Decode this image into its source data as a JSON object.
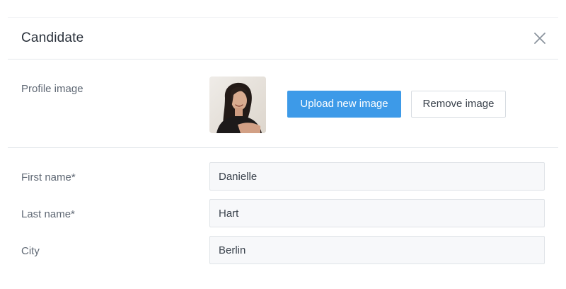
{
  "dialog": {
    "title": "Candidate",
    "close_icon": "close-icon"
  },
  "profile": {
    "label": "Profile image",
    "avatar_icon": "candidate-photo",
    "upload_label": "Upload new image",
    "remove_label": "Remove image"
  },
  "form": {
    "first_name": {
      "label": "First name*",
      "value": "Danielle"
    },
    "last_name": {
      "label": "Last name*",
      "value": "Hart"
    },
    "city": {
      "label": "City",
      "value": "Berlin"
    }
  },
  "colors": {
    "primary_button": "#3d9ae8",
    "field_background": "#f7f8fa",
    "divider": "#e3e6ea"
  }
}
